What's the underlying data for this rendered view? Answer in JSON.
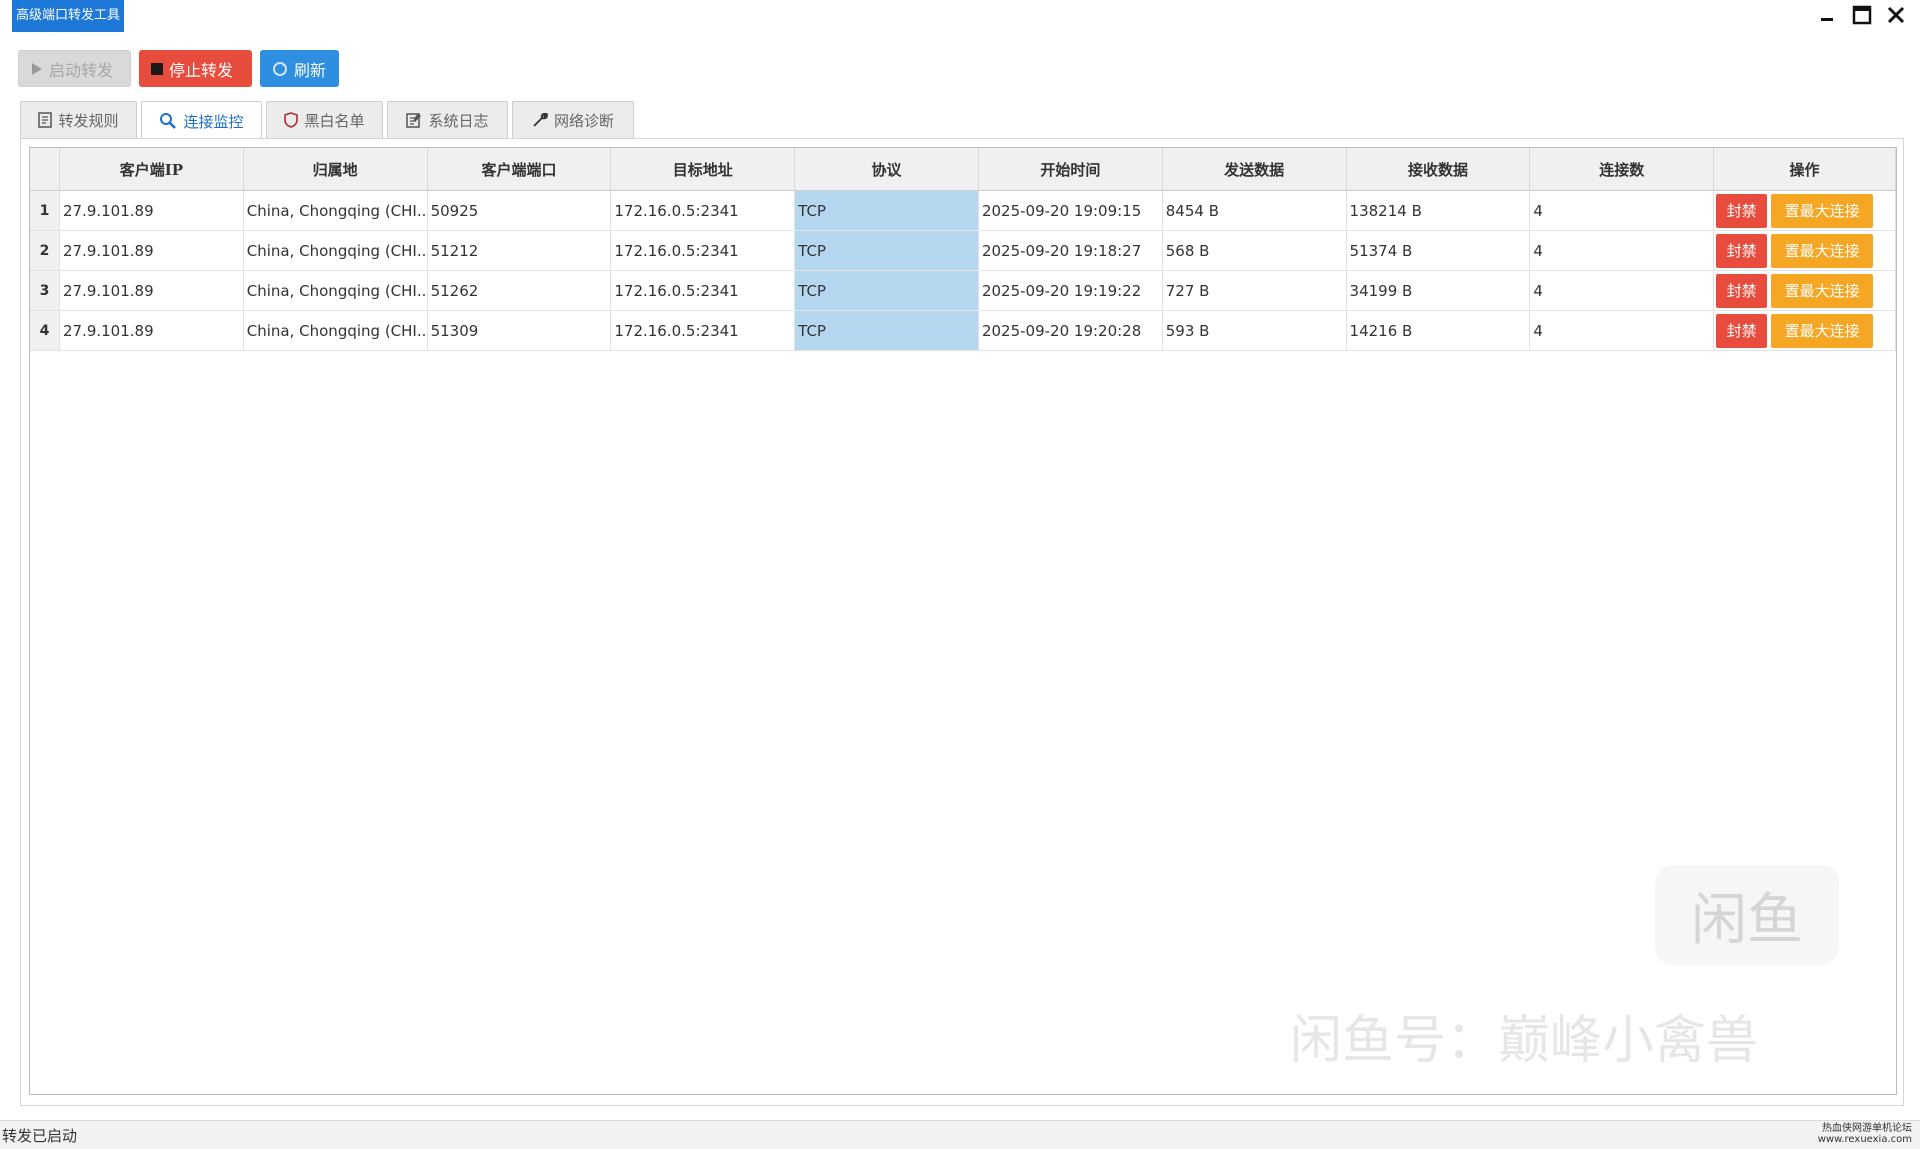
{
  "window": {
    "title": "高级端口转发工具",
    "controls": [
      "minimize-icon",
      "maximize-icon",
      "close-icon"
    ]
  },
  "toolbar": {
    "start_label": "启动转发",
    "stop_label": "停止转发",
    "refresh_label": "刷新"
  },
  "tabs": [
    {
      "label": "转发规则",
      "icon": "document-icon",
      "active": false
    },
    {
      "label": "连接监控",
      "icon": "search-icon",
      "active": true
    },
    {
      "label": "黑白名单",
      "icon": "shield-icon",
      "active": false
    },
    {
      "label": "系统日志",
      "icon": "log-icon",
      "active": false
    },
    {
      "label": "网络诊断",
      "icon": "wrench-icon",
      "active": false
    }
  ],
  "table": {
    "columns": [
      "客户端IP",
      "归属地",
      "客户端端口",
      "目标地址",
      "协议",
      "开始时间",
      "发送数据",
      "接收数据",
      "连接数",
      "操作"
    ],
    "rows": [
      {
        "index": "1",
        "ip": "27.9.101.89",
        "location": "China, Chongqing (CHI...",
        "port": "50925",
        "target": "172.16.0.5:2341",
        "protocol": "TCP",
        "start": "2025-09-20 19:09:15",
        "sent": "8454 B",
        "received": "138214 B",
        "connections": "4"
      },
      {
        "index": "2",
        "ip": "27.9.101.89",
        "location": "China, Chongqing (CHI...",
        "port": "51212",
        "target": "172.16.0.5:2341",
        "protocol": "TCP",
        "start": "2025-09-20 19:18:27",
        "sent": "568 B",
        "received": "51374 B",
        "connections": "4"
      },
      {
        "index": "3",
        "ip": "27.9.101.89",
        "location": "China, Chongqing (CHI...",
        "port": "51262",
        "target": "172.16.0.5:2341",
        "protocol": "TCP",
        "start": "2025-09-20 19:19:22",
        "sent": "727 B",
        "received": "34199 B",
        "connections": "4"
      },
      {
        "index": "4",
        "ip": "27.9.101.89",
        "location": "China, Chongqing (CHI...",
        "port": "51309",
        "target": "172.16.0.5:2341",
        "protocol": "TCP",
        "start": "2025-09-20 19:20:28",
        "sent": "593 B",
        "received": "14216 B",
        "connections": "4"
      }
    ],
    "ban_label": "封禁",
    "max_conn_label": "置最大连接"
  },
  "watermark": {
    "logo": "闲鱼",
    "text": "闲鱼号：巅峰小禽兽"
  },
  "status": {
    "text": "转发已启动",
    "corner_line1": "热血侠网游单机论坛",
    "corner_line2": "www.rexuexia.com"
  },
  "colors": {
    "title_bg": "#1e78d7",
    "stop_button": "#e74c3c",
    "refresh_button": "#2e8ee0",
    "ban_button": "#e74c3c",
    "max_conn_button": "#f5a623",
    "protocol_highlight": "#b6d7f0",
    "active_tab_text": "#1e6fc9"
  }
}
